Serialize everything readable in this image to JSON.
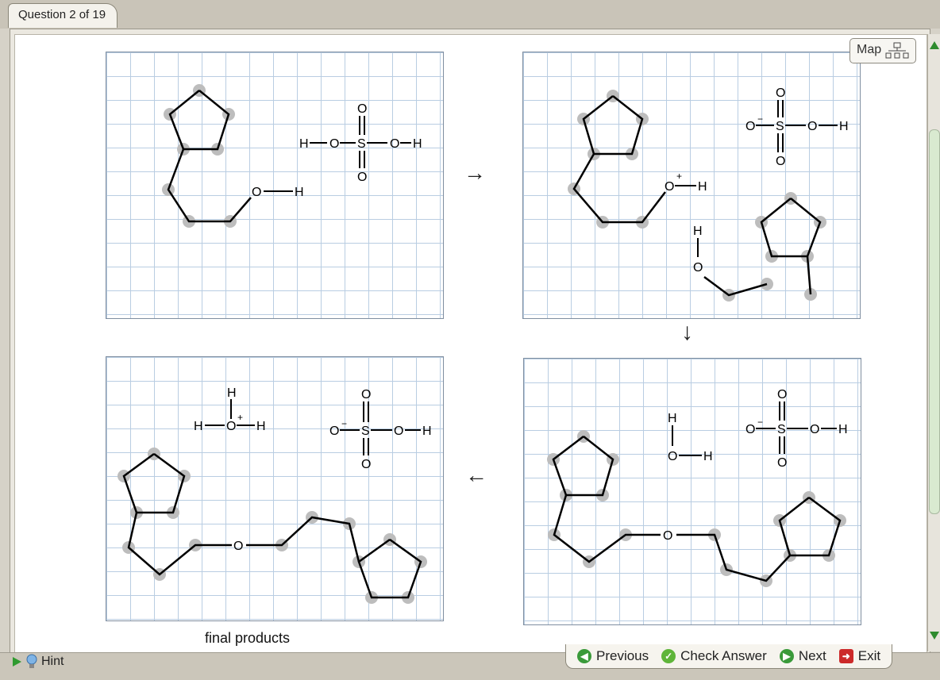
{
  "tab": {
    "title": "Question 2 of 19"
  },
  "map_button": {
    "label": "Map"
  },
  "caption": "final products",
  "hint": {
    "label": "Hint"
  },
  "nav": {
    "previous": "Previous",
    "check": "Check Answer",
    "next": "Next",
    "exit": "Exit"
  },
  "arrows": {
    "right": "→",
    "down": "↓",
    "left": "←"
  },
  "icons": [
    "map-tree-icon",
    "play-icon",
    "lightbulb-icon",
    "previous-icon",
    "check-icon",
    "next-icon",
    "exit-icon",
    "scroll-up-icon",
    "scroll-down-icon"
  ],
  "atoms": {
    "O": "O",
    "H": "H",
    "S": "S",
    "plus": "+",
    "minus": "−"
  }
}
